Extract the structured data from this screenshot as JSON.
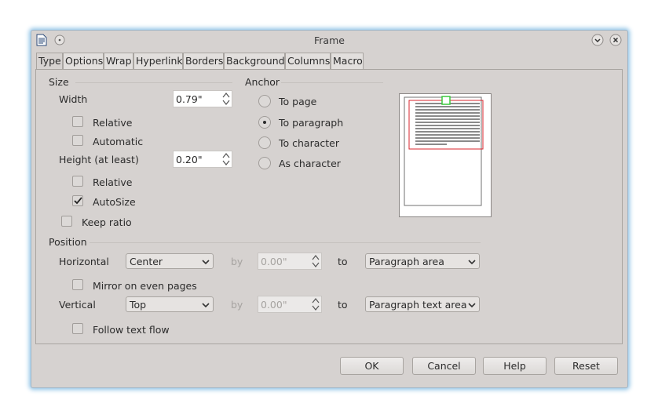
{
  "window": {
    "title": "Frame"
  },
  "tabs": [
    {
      "label": "Type",
      "active": true
    },
    {
      "label": "Options",
      "active": false
    },
    {
      "label": "Wrap",
      "active": false
    },
    {
      "label": "Hyperlink",
      "active": false
    },
    {
      "label": "Borders",
      "active": false
    },
    {
      "label": "Background",
      "active": false
    },
    {
      "label": "Columns",
      "active": false
    },
    {
      "label": "Macro",
      "active": false
    }
  ],
  "size": {
    "section_label": "Size",
    "width_label": "Width",
    "width_value": "0.79\"",
    "width_relative_label": "Relative",
    "width_relative_checked": false,
    "width_automatic_label": "Automatic",
    "width_automatic_checked": false,
    "height_label": "Height (at least)",
    "height_value": "0.20\"",
    "height_relative_label": "Relative",
    "height_relative_checked": false,
    "autosize_label": "AutoSize",
    "autosize_checked": true,
    "keep_ratio_label": "Keep ratio",
    "keep_ratio_checked": false
  },
  "anchor": {
    "section_label": "Anchor",
    "options": [
      {
        "label": "To page",
        "selected": false
      },
      {
        "label": "To paragraph",
        "selected": true
      },
      {
        "label": "To character",
        "selected": false
      },
      {
        "label": "As character",
        "selected": false
      }
    ]
  },
  "position": {
    "section_label": "Position",
    "horizontal_label": "Horizontal",
    "horizontal_value": "Center",
    "horizontal_by_label": "by",
    "horizontal_by_value": "0.00\"",
    "horizontal_to_label": "to",
    "horizontal_to_value": "Paragraph area",
    "mirror_label": "Mirror on even pages",
    "mirror_checked": false,
    "vertical_label": "Vertical",
    "vertical_value": "Top",
    "vertical_by_label": "by",
    "vertical_by_value": "0.00\"",
    "vertical_to_label": "to",
    "vertical_to_value": "Paragraph text area",
    "follow_text_flow_label": "Follow text flow",
    "follow_text_flow_checked": false
  },
  "buttons": {
    "ok": "OK",
    "cancel": "Cancel",
    "help": "Help",
    "reset": "Reset"
  },
  "icons": {
    "app": "document-icon",
    "menu": "window-menu-icon",
    "minimize": "minimize-icon",
    "close": "close-icon"
  },
  "colors": {
    "window_bg": "#d6d2d0",
    "focus_glow": "#8fc3e6",
    "preview_frame": "#d9252c",
    "preview_anchor": "#3cc83c"
  }
}
